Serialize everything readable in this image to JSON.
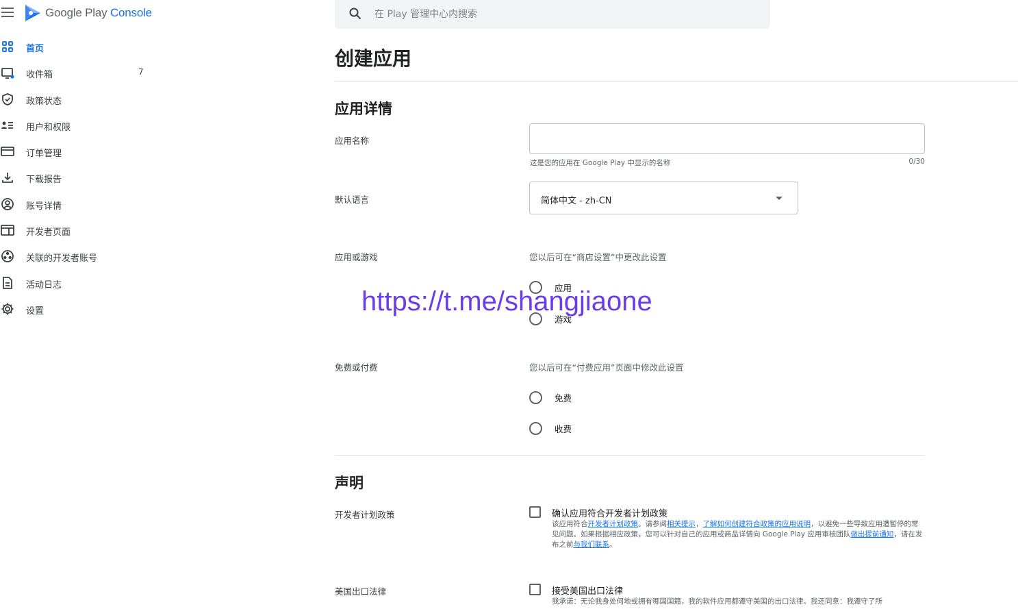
{
  "brand": {
    "name_part1": "Google Play",
    "name_part2": "Console",
    "accent_color": "#1a73e8"
  },
  "sidebar": {
    "items": [
      {
        "label": "首页",
        "icon": "dashboard-icon",
        "active": true
      },
      {
        "label": "收件箱",
        "icon": "inbox-icon",
        "badge": "7"
      },
      {
        "label": "政策状态",
        "icon": "shield-check-icon"
      },
      {
        "label": "用户和权限",
        "icon": "users-icon"
      },
      {
        "label": "订单管理",
        "icon": "credit-card-icon"
      },
      {
        "label": "下载报告",
        "icon": "download-icon"
      },
      {
        "label": "账号详情",
        "icon": "account-circle-icon"
      },
      {
        "label": "开发者页面",
        "icon": "web-icon"
      },
      {
        "label": "关联的开发者账号",
        "icon": "linked-accounts-icon"
      },
      {
        "label": "活动日志",
        "icon": "document-icon"
      },
      {
        "label": "设置",
        "icon": "gear-icon"
      }
    ]
  },
  "search": {
    "placeholder": "在 Play 管理中心内搜索"
  },
  "page": {
    "title": "创建应用"
  },
  "details": {
    "section_title": "应用详情",
    "app_name": {
      "label": "应用名称",
      "value": "",
      "helper": "这是您的应用在 Google Play 中显示的名称",
      "counter": "0/30"
    },
    "default_language": {
      "label": "默认语言",
      "value": "简体中文 - zh-CN"
    },
    "app_or_game": {
      "label": "应用或游戏",
      "note": "您以后可在“商店设置”中更改此设置",
      "options": [
        "应用",
        "游戏"
      ]
    },
    "free_or_paid": {
      "label": "免费或付费",
      "note": "您以后可在“付费应用”页面中修改此设置",
      "options": [
        "免费",
        "收费"
      ]
    }
  },
  "declarations": {
    "section_title": "声明",
    "developer_policy": {
      "label": "开发者计划政策",
      "checkbox_title": "确认应用符合开发者计划政策",
      "desc": {
        "t1": "该应用符合",
        "l1": "开发者计划政策",
        "t2": "。请参阅",
        "l2": "相关提示",
        "t3": "，",
        "l3": "了解如何创建符合政策的应用说明",
        "t4": "，以避免一些导致应用遭暂停的常见问题。如果根据相应政策，您可以针对自己的应用或商品详情向 Google Play 应用审核团队",
        "l4": "做出提前通知",
        "t5": "，请在发布之前",
        "l5": "与我们联系",
        "t6": "。"
      }
    },
    "us_export": {
      "label": "美国出口法律",
      "checkbox_title": "接受美国出口法律",
      "desc": "我承诺：无论我身处何地或拥有哪国国籍，我的软件应用都遵守美国的出口法律。我还同意：我遵守了所"
    }
  },
  "watermark": "https://t.me/shangjiaone"
}
